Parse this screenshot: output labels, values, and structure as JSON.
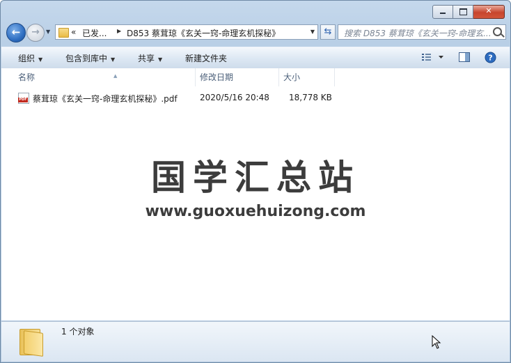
{
  "window": {
    "minimize_glyph": "",
    "close_glyph": "✕"
  },
  "address": {
    "overflow": "«",
    "crumb1": "已发...",
    "crumb2": "D853 蔡茸琼《玄关一窍-命理玄机探秘》"
  },
  "search": {
    "placeholder": "搜索 D853 蔡茸琼《玄关一窍-命理玄..."
  },
  "toolbar": {
    "organize": "组织",
    "include_in_library": "包含到库中",
    "share": "共享",
    "new_folder": "新建文件夹"
  },
  "columns": {
    "name": "名称",
    "date_modified": "修改日期",
    "size": "大小"
  },
  "files": [
    {
      "name": "蔡茸琼《玄关一窍-命理玄机探秘》.pdf",
      "date_modified": "2020/5/16 20:48",
      "size": "18,778 KB",
      "icon": "pdf-file-icon"
    }
  ],
  "watermark": {
    "title": "国学汇总站",
    "url": "www.guoxuehuizong.com"
  },
  "details": {
    "count": "1 个对象"
  }
}
